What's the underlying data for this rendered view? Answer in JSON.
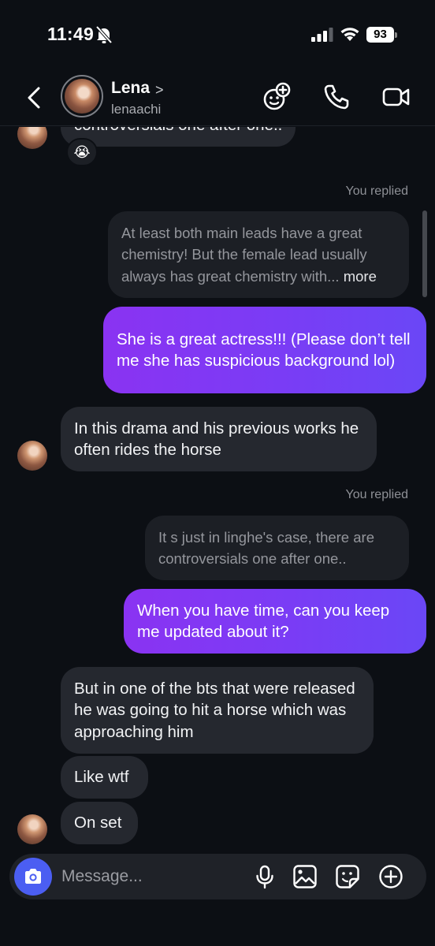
{
  "status_bar": {
    "time": "11:49",
    "battery": "93"
  },
  "header": {
    "name": "Lena",
    "chevron": ">",
    "handle": "lenaachi"
  },
  "colors": {
    "accent": "#7a3cf5",
    "incoming_bubble": "#25282f",
    "background": "#0c0f14",
    "camera_button": "#4b5ef2"
  },
  "messages": {
    "top_partial": "controversials one after one..",
    "top_reaction": "😭",
    "replied_label_1": "You replied",
    "quote_1": "At least both main leads have a great chemistry! But the female lead usually always has great chemistry with...",
    "quote_1_more": "more",
    "out_1": "She is a great actress!!! (Please don’t tell me she has suspicious background lol)",
    "in_1": "In this drama and his previous works he often rides the horse",
    "replied_label_2": "You replied",
    "quote_2": "It s just in linghe's case, there are controversials one after one..",
    "out_2": "When you have time, can you keep me updated about it?",
    "in_2": "But in one of the bts that were released he was going to hit a horse which was approaching him",
    "in_3": "Like wtf",
    "in_4": "On set"
  },
  "composer": {
    "placeholder": "Message..."
  },
  "icons": [
    "bell-off-icon",
    "signal-icon",
    "wifi-icon",
    "battery-icon",
    "back-icon",
    "effects-icon",
    "phone-icon",
    "video-icon",
    "camera-icon",
    "mic-icon",
    "gallery-icon",
    "sticker-icon",
    "plus-icon"
  ]
}
